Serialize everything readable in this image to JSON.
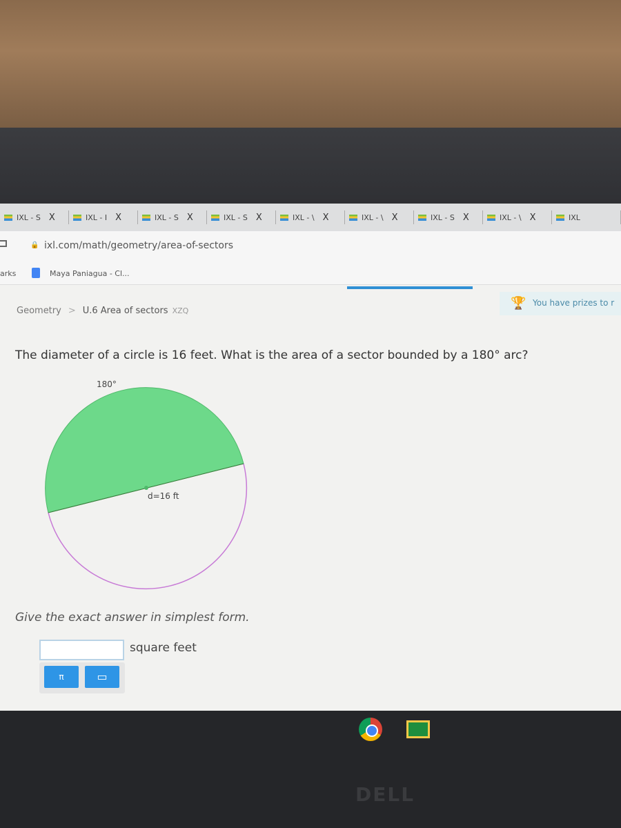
{
  "browser": {
    "tabs": [
      {
        "label": "IXL - S"
      },
      {
        "label": "IXL - I"
      },
      {
        "label": "IXL - S"
      },
      {
        "label": "IXL - S"
      },
      {
        "label": "IXL - \\"
      },
      {
        "label": "IXL - \\"
      },
      {
        "label": "IXL - S"
      },
      {
        "label": "IXL - \\"
      },
      {
        "label": "IXL"
      }
    ],
    "tab_close": "X",
    "url": "ixl.com/math/geometry/area-of-sectors",
    "bookmarks_label": "arks",
    "bookmark": "Maya Paniagua - Cl..."
  },
  "breadcrumb": {
    "subject": "Geometry",
    "sep": ">",
    "skill": "U.6 Area of sectors",
    "code": "XZQ"
  },
  "prize_text": "You have prizes to r",
  "question": "The diameter of a circle is 16 feet. What is the area of a sector bounded by a 180° arc?",
  "figure": {
    "arc_label": "180°",
    "diameter_label": "d=16 ft",
    "sector_color": "#6dd98a",
    "circle_color": "#c77ad6"
  },
  "instruction": "Give the exact answer in simplest form.",
  "answer": {
    "value": "",
    "unit": "square feet"
  },
  "keypad": {
    "pi": "π",
    "fraction": "⅟"
  },
  "brand": "DELL"
}
